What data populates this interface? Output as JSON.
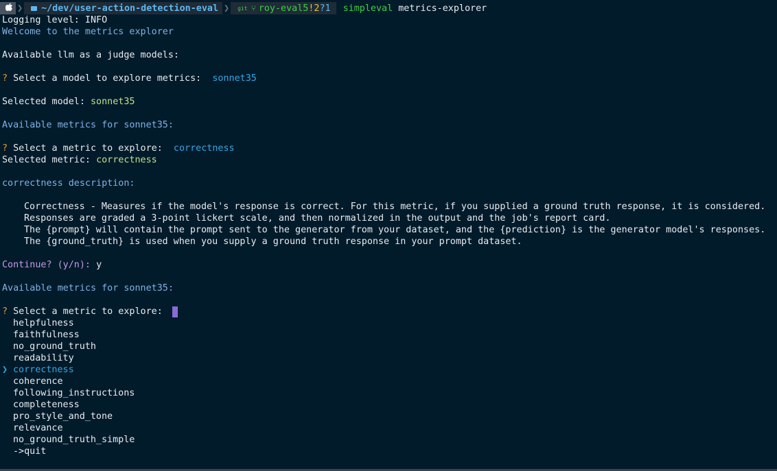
{
  "prompt": {
    "directory": "~/dev/user-action-detection-eval",
    "git_label": "git",
    "branch": "roy-eval5",
    "git_modified": "!2",
    "git_untracked": "?1",
    "command_name": "simpleval",
    "command_args": "metrics-explorer"
  },
  "output": {
    "logging": "Logging level: INFO",
    "welcome": "Welcome to the metrics explorer",
    "available_models": "Available llm as a judge models:",
    "q_mark": "?",
    "select_model_q": "Select a model to explore metrics:",
    "select_model_answer": "sonnet35",
    "selected_model_label": "Selected model:",
    "selected_model_value": "sonnet35",
    "available_metrics_1": "Available metrics for sonnet35:",
    "select_metric_q": "Select a metric to explore:",
    "select_metric_answer": "correctness",
    "selected_metric_label": "Selected metric:",
    "selected_metric_value": "correctness",
    "description_header": "correctness description:",
    "description_lines": [
      "Correctness - Measures if the model's response is correct. For this metric, if you supplied a ground truth response, it is considered.",
      "Responses are graded a 3-point lickert scale, and then normalized in the output and the job's report card.",
      "The {prompt} will contain the prompt sent to the generator from your dataset, and the {prediction} is the generator model's responses.",
      "The {ground_truth} is used when you supply a ground truth response in your prompt dataset."
    ],
    "continue_q": "Continue? (y/n):",
    "continue_answer": "y",
    "available_metrics_2": "Available metrics for sonnet35:",
    "select_metric_q2": "Select a metric to explore:",
    "pointer": "❯",
    "options": [
      "helpfulness",
      "faithfulness",
      "no_ground_truth",
      "readability",
      "correctness",
      "coherence",
      "following_instructions",
      "completeness",
      "pro_style_and_tone",
      "relevance",
      "no_ground_truth_simple",
      "->quit"
    ],
    "selected_option": "correctness"
  },
  "colors": {
    "background": "#021b2b",
    "accent_blue": "#7fb2e6",
    "answer_cyan": "#37a6e0",
    "value_green": "#bfe08a",
    "question_orange": "#e89a2e",
    "continue_purple": "#c39ae6",
    "cursor": "#8a6ad6"
  },
  "icons": [
    "apple-icon",
    "folder-icon",
    "git-branch-icon"
  ]
}
